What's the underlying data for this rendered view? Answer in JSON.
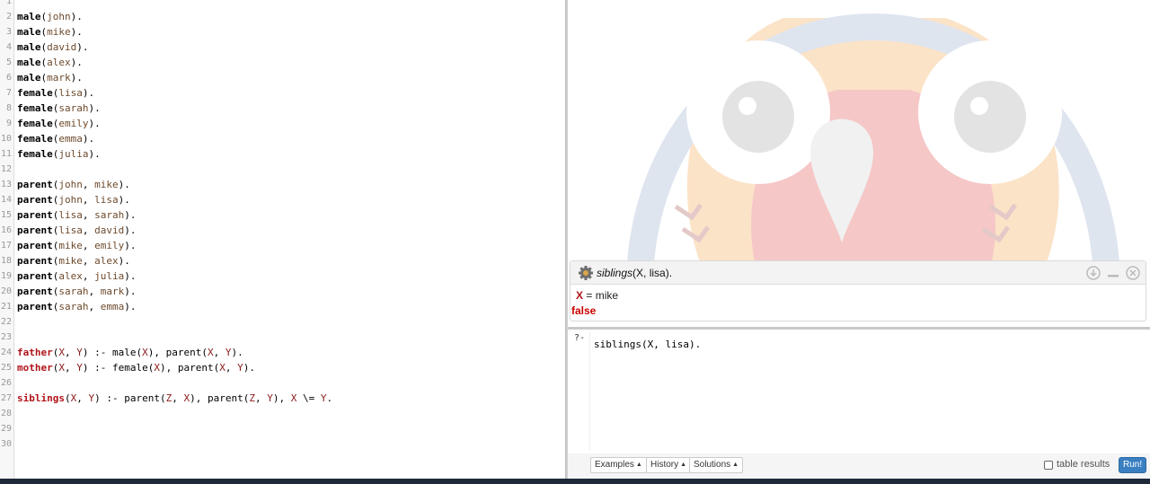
{
  "editor": {
    "lines": [
      {
        "n": "1",
        "tokens": []
      },
      {
        "n": "2",
        "tokens": [
          {
            "t": "male",
            "c": "pred"
          },
          {
            "t": "(",
            "c": "punc"
          },
          {
            "t": "john",
            "c": "atom"
          },
          {
            "t": ").",
            "c": "punc"
          }
        ]
      },
      {
        "n": "3",
        "tokens": [
          {
            "t": "male",
            "c": "pred"
          },
          {
            "t": "(",
            "c": "punc"
          },
          {
            "t": "mike",
            "c": "atom"
          },
          {
            "t": ").",
            "c": "punc"
          }
        ]
      },
      {
        "n": "4",
        "tokens": [
          {
            "t": "male",
            "c": "pred"
          },
          {
            "t": "(",
            "c": "punc"
          },
          {
            "t": "david",
            "c": "atom"
          },
          {
            "t": ").",
            "c": "punc"
          }
        ]
      },
      {
        "n": "5",
        "tokens": [
          {
            "t": "male",
            "c": "pred"
          },
          {
            "t": "(",
            "c": "punc"
          },
          {
            "t": "alex",
            "c": "atom"
          },
          {
            "t": ").",
            "c": "punc"
          }
        ]
      },
      {
        "n": "6",
        "tokens": [
          {
            "t": "male",
            "c": "pred"
          },
          {
            "t": "(",
            "c": "punc"
          },
          {
            "t": "mark",
            "c": "atom"
          },
          {
            "t": ").",
            "c": "punc"
          }
        ]
      },
      {
        "n": "7",
        "tokens": [
          {
            "t": "female",
            "c": "pred"
          },
          {
            "t": "(",
            "c": "punc"
          },
          {
            "t": "lisa",
            "c": "atom"
          },
          {
            "t": ").",
            "c": "punc"
          }
        ]
      },
      {
        "n": "8",
        "tokens": [
          {
            "t": "female",
            "c": "pred"
          },
          {
            "t": "(",
            "c": "punc"
          },
          {
            "t": "sarah",
            "c": "atom"
          },
          {
            "t": ").",
            "c": "punc"
          }
        ]
      },
      {
        "n": "9",
        "tokens": [
          {
            "t": "female",
            "c": "pred"
          },
          {
            "t": "(",
            "c": "punc"
          },
          {
            "t": "emily",
            "c": "atom"
          },
          {
            "t": ").",
            "c": "punc"
          }
        ]
      },
      {
        "n": "10",
        "tokens": [
          {
            "t": "female",
            "c": "pred"
          },
          {
            "t": "(",
            "c": "punc"
          },
          {
            "t": "emma",
            "c": "atom"
          },
          {
            "t": ").",
            "c": "punc"
          }
        ]
      },
      {
        "n": "11",
        "tokens": [
          {
            "t": "female",
            "c": "pred"
          },
          {
            "t": "(",
            "c": "punc"
          },
          {
            "t": "julia",
            "c": "atom"
          },
          {
            "t": ").",
            "c": "punc"
          }
        ]
      },
      {
        "n": "12",
        "tokens": []
      },
      {
        "n": "13",
        "tokens": [
          {
            "t": "parent",
            "c": "pred"
          },
          {
            "t": "(",
            "c": "punc"
          },
          {
            "t": "john",
            "c": "atom"
          },
          {
            "t": ", ",
            "c": "punc"
          },
          {
            "t": "mike",
            "c": "atom"
          },
          {
            "t": ").",
            "c": "punc"
          }
        ]
      },
      {
        "n": "14",
        "tokens": [
          {
            "t": "parent",
            "c": "pred"
          },
          {
            "t": "(",
            "c": "punc"
          },
          {
            "t": "john",
            "c": "atom"
          },
          {
            "t": ", ",
            "c": "punc"
          },
          {
            "t": "lisa",
            "c": "atom"
          },
          {
            "t": ").",
            "c": "punc"
          }
        ]
      },
      {
        "n": "15",
        "tokens": [
          {
            "t": "parent",
            "c": "pred"
          },
          {
            "t": "(",
            "c": "punc"
          },
          {
            "t": "lisa",
            "c": "atom"
          },
          {
            "t": ", ",
            "c": "punc"
          },
          {
            "t": "sarah",
            "c": "atom"
          },
          {
            "t": ").",
            "c": "punc"
          }
        ]
      },
      {
        "n": "16",
        "tokens": [
          {
            "t": "parent",
            "c": "pred"
          },
          {
            "t": "(",
            "c": "punc"
          },
          {
            "t": "lisa",
            "c": "atom"
          },
          {
            "t": ", ",
            "c": "punc"
          },
          {
            "t": "david",
            "c": "atom"
          },
          {
            "t": ").",
            "c": "punc"
          }
        ]
      },
      {
        "n": "17",
        "tokens": [
          {
            "t": "parent",
            "c": "pred"
          },
          {
            "t": "(",
            "c": "punc"
          },
          {
            "t": "mike",
            "c": "atom"
          },
          {
            "t": ", ",
            "c": "punc"
          },
          {
            "t": "emily",
            "c": "atom"
          },
          {
            "t": ").",
            "c": "punc"
          }
        ]
      },
      {
        "n": "18",
        "tokens": [
          {
            "t": "parent",
            "c": "pred"
          },
          {
            "t": "(",
            "c": "punc"
          },
          {
            "t": "mike",
            "c": "atom"
          },
          {
            "t": ", ",
            "c": "punc"
          },
          {
            "t": "alex",
            "c": "atom"
          },
          {
            "t": ").",
            "c": "punc"
          }
        ]
      },
      {
        "n": "19",
        "tokens": [
          {
            "t": "parent",
            "c": "pred"
          },
          {
            "t": "(",
            "c": "punc"
          },
          {
            "t": "alex",
            "c": "atom"
          },
          {
            "t": ", ",
            "c": "punc"
          },
          {
            "t": "julia",
            "c": "atom"
          },
          {
            "t": ").",
            "c": "punc"
          }
        ]
      },
      {
        "n": "20",
        "tokens": [
          {
            "t": "parent",
            "c": "pred"
          },
          {
            "t": "(",
            "c": "punc"
          },
          {
            "t": "sarah",
            "c": "atom"
          },
          {
            "t": ", ",
            "c": "punc"
          },
          {
            "t": "mark",
            "c": "atom"
          },
          {
            "t": ").",
            "c": "punc"
          }
        ]
      },
      {
        "n": "21",
        "tokens": [
          {
            "t": "parent",
            "c": "pred"
          },
          {
            "t": "(",
            "c": "punc"
          },
          {
            "t": "sarah",
            "c": "atom"
          },
          {
            "t": ", ",
            "c": "punc"
          },
          {
            "t": "emma",
            "c": "atom"
          },
          {
            "t": ").",
            "c": "punc"
          }
        ]
      },
      {
        "n": "22",
        "tokens": []
      },
      {
        "n": "23",
        "tokens": []
      },
      {
        "n": "24",
        "tokens": [
          {
            "t": "father",
            "c": "head"
          },
          {
            "t": "(",
            "c": "punc"
          },
          {
            "t": "X",
            "c": "var"
          },
          {
            "t": ", ",
            "c": "punc"
          },
          {
            "t": "Y",
            "c": "var"
          },
          {
            "t": ") :- ",
            "c": "op"
          },
          {
            "t": "male",
            "c": "call"
          },
          {
            "t": "(",
            "c": "punc"
          },
          {
            "t": "X",
            "c": "var"
          },
          {
            "t": "), ",
            "c": "punc"
          },
          {
            "t": "parent",
            "c": "call"
          },
          {
            "t": "(",
            "c": "punc"
          },
          {
            "t": "X",
            "c": "var"
          },
          {
            "t": ", ",
            "c": "punc"
          },
          {
            "t": "Y",
            "c": "var"
          },
          {
            "t": ").",
            "c": "punc"
          }
        ]
      },
      {
        "n": "25",
        "tokens": [
          {
            "t": "mother",
            "c": "head"
          },
          {
            "t": "(",
            "c": "punc"
          },
          {
            "t": "X",
            "c": "var"
          },
          {
            "t": ", ",
            "c": "punc"
          },
          {
            "t": "Y",
            "c": "var"
          },
          {
            "t": ") :- ",
            "c": "op"
          },
          {
            "t": "female",
            "c": "call"
          },
          {
            "t": "(",
            "c": "punc"
          },
          {
            "t": "X",
            "c": "var"
          },
          {
            "t": "), ",
            "c": "punc"
          },
          {
            "t": "parent",
            "c": "call"
          },
          {
            "t": "(",
            "c": "punc"
          },
          {
            "t": "X",
            "c": "var"
          },
          {
            "t": ", ",
            "c": "punc"
          },
          {
            "t": "Y",
            "c": "var"
          },
          {
            "t": ").",
            "c": "punc"
          }
        ]
      },
      {
        "n": "26",
        "tokens": []
      },
      {
        "n": "27",
        "tokens": [
          {
            "t": "siblings",
            "c": "head"
          },
          {
            "t": "(",
            "c": "punc"
          },
          {
            "t": "X",
            "c": "var"
          },
          {
            "t": ", ",
            "c": "punc"
          },
          {
            "t": "Y",
            "c": "var"
          },
          {
            "t": ") :- ",
            "c": "op"
          },
          {
            "t": "parent",
            "c": "call"
          },
          {
            "t": "(",
            "c": "punc"
          },
          {
            "t": "Z",
            "c": "var"
          },
          {
            "t": ", ",
            "c": "punc"
          },
          {
            "t": "X",
            "c": "var"
          },
          {
            "t": "), ",
            "c": "punc"
          },
          {
            "t": "parent",
            "c": "call"
          },
          {
            "t": "(",
            "c": "punc"
          },
          {
            "t": "Z",
            "c": "var"
          },
          {
            "t": ", ",
            "c": "punc"
          },
          {
            "t": "Y",
            "c": "var"
          },
          {
            "t": "), ",
            "c": "punc"
          },
          {
            "t": "X",
            "c": "var"
          },
          {
            "t": " \\= ",
            "c": "op"
          },
          {
            "t": "Y",
            "c": "var"
          },
          {
            "t": ".",
            "c": "punc"
          }
        ]
      },
      {
        "n": "28",
        "tokens": []
      },
      {
        "n": "29",
        "tokens": []
      },
      {
        "n": "30",
        "tokens": []
      }
    ]
  },
  "answer": {
    "query_name": "siblings",
    "query_args": "(X, lisa).",
    "binding_var": "X",
    "binding_eq": " = mike",
    "result": "false",
    "icons": [
      "gear-icon",
      "download-icon",
      "minimize-icon",
      "close-icon"
    ]
  },
  "query": {
    "prompt": "?-",
    "text": "siblings(X, lisa)."
  },
  "toolbar": {
    "examples_label": "Examples",
    "history_label": "History",
    "solutions_label": "Solutions",
    "caret": "▲",
    "table_results_label": "table results",
    "table_results_checked": false,
    "run_label": "Run!"
  },
  "colors": {
    "atom": "#6e4a2c",
    "variable": "#8a1818",
    "rule_head": "#b0141a",
    "false": "#cc0000",
    "run_button": "#3a7fc1",
    "taskbar": "#1e2a3a"
  }
}
